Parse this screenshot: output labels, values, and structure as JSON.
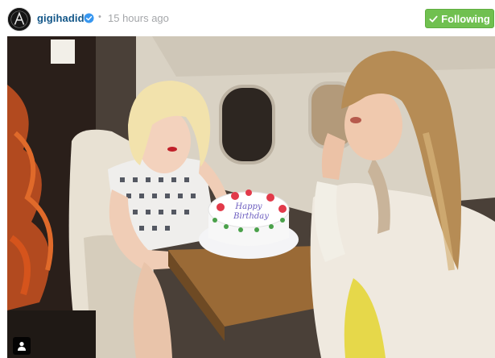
{
  "post": {
    "username": "gigihadid",
    "separator": "•",
    "timestamp": "15 hours ago",
    "follow_label": "Following",
    "verified_icon": "verified-badge-icon",
    "follow_icon": "checkmark-icon",
    "tag_icon": "person-tag-icon"
  },
  "photo": {
    "cake_text_line1": "Happy",
    "cake_text_line2": "Birthday"
  },
  "colors": {
    "username": "#125688",
    "timestamp": "#a5a7aa",
    "follow_button": "#70c050",
    "verified_badge": "#3897f0"
  }
}
